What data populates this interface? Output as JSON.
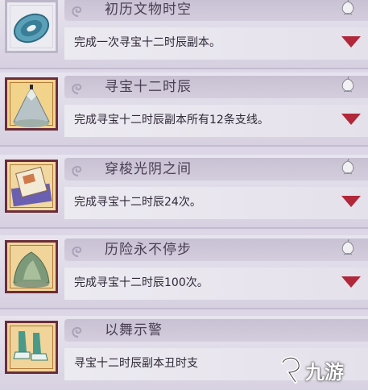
{
  "achievements": [
    {
      "title": "初历文物时空",
      "description": "完成一次寻宝十二时辰副本。",
      "icon": "jade-disc-icon",
      "reward_icon": "peach-icon",
      "expand_icon": "triangle-down-icon"
    },
    {
      "title": "寻宝十二时辰",
      "description": "完成寻宝十二时辰副本所有12条支线。",
      "icon": "mountain-figure-icon",
      "reward_icon": "peach-icon",
      "expand_icon": "triangle-down-icon"
    },
    {
      "title": "穿梭光阴之间",
      "description": "完成寻宝十二时辰24次。",
      "icon": "scroll-book-icon",
      "reward_icon": "peach-icon",
      "expand_icon": "triangle-down-icon"
    },
    {
      "title": "历险永不停步",
      "description": "完成寻宝十二时辰100次。",
      "icon": "rock-mountain-icon",
      "reward_icon": "peach-icon",
      "expand_icon": "triangle-down-icon"
    },
    {
      "title": "以舞示警",
      "description": "寻宝十二时辰副本丑时支",
      "icon": "dancing-feet-icon",
      "reward_icon": "",
      "expand_icon": ""
    }
  ],
  "watermark": {
    "text": "九游",
    "icon": "jiuyou-logo-icon"
  },
  "colors": {
    "frame": "#6b2d3a",
    "arrow": "#b0283a",
    "title_text": "#4a3f52"
  }
}
